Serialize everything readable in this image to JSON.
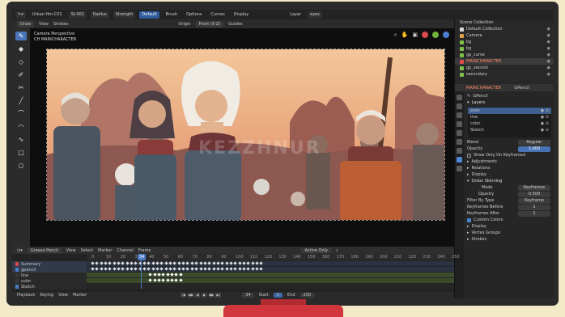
{
  "topbar": {
    "scene_menu": "Draw",
    "file_name": "Urban Hm-C01",
    "frame_label": "St.001",
    "mode_a": "Radius",
    "mode_b": "Strength",
    "active_object": "Default",
    "menus": [
      "Brush",
      "Options",
      "Curves",
      "Display"
    ],
    "layer_label": "Layer",
    "layer_value": "eyes"
  },
  "toolheader": {
    "mode": "Draw",
    "view": "View",
    "strokes": "Strokes",
    "origin_label": "Origin",
    "origin_value": "Front (X-Z)",
    "guides": "Guides"
  },
  "viewport": {
    "camera_label": "Camera Perspective",
    "object_label": "CH MAINCHARACTER",
    "watermark": "KEZZHNUR"
  },
  "tools": [
    "draw",
    "fill",
    "erase",
    "tint",
    "cutter",
    "line",
    "polyline",
    "arc",
    "curve",
    "box",
    "circle"
  ],
  "outliner": {
    "title": "Scene Collection",
    "items": [
      {
        "label": "Default Collection",
        "color": "#d8d8d8"
      },
      {
        "label": "Camera",
        "color": "#e2a24b"
      },
      {
        "label": "bg",
        "color": "#7fc14a"
      },
      {
        "label": "bg",
        "color": "#7fc14a"
      },
      {
        "label": "gp_curve",
        "color": "#7fc14a"
      },
      {
        "label": "MAINCHARACTER",
        "color": "#e04a4a"
      },
      {
        "label": "gp_second",
        "color": "#7fc14a"
      },
      {
        "label": "secondary",
        "color": "#7fc14a"
      }
    ]
  },
  "properties": {
    "header_obj": "MAINCHARACTER",
    "header_data": "GPencil",
    "datablock": "GPencil",
    "layers_title": "Layers",
    "layers": [
      "eyes",
      "line",
      "color",
      "Sketch"
    ],
    "blend_label": "Blend",
    "blend_value": "Regular",
    "opacity_label": "Opacity",
    "opacity_value": "1.000",
    "show_only_keyframed": "Show Only On Keyframed",
    "adjustments": "Adjustments",
    "relations": "Relations",
    "display": "Display",
    "onion_title": "Onion Skinning",
    "mode_label": "Mode",
    "mode_value": "Keyframes",
    "onion_opacity_label": "Opacity",
    "onion_opacity_value": "0.500",
    "filter_label": "Filter By Type",
    "filter_value": "Keyframe",
    "kf_before_label": "Keyframes Before",
    "kf_before_value": "1",
    "kf_after_label": "Keyframes After",
    "kf_after_value": "1",
    "custom_colors": "Custom Colors",
    "display2": "Display",
    "vertex_groups": "Vertex Groups",
    "strokes": "Strokes"
  },
  "timeline": {
    "mode": "Grease Pencil",
    "menus": [
      "View",
      "Select",
      "Marker",
      "Channel",
      "Frame"
    ],
    "filter": "Active Only",
    "current_frame": "34",
    "ruler": [
      "0",
      "10",
      "20",
      "30",
      "40",
      "50",
      "60",
      "70",
      "80",
      "90",
      "100",
      "110",
      "120",
      "130",
      "140",
      "150",
      "160",
      "170",
      "180",
      "190",
      "200",
      "210",
      "220",
      "230",
      "240",
      "250"
    ],
    "channels": [
      {
        "label": "Summary",
        "color": "#d04a4a"
      },
      {
        "label": "gpencil",
        "color": "#4a7ec8"
      },
      {
        "label": "line",
        "color": "#3a3a3a"
      },
      {
        "label": "color",
        "color": "#3a3a3a"
      },
      {
        "label": "Sketch",
        "color": "#4a7ec8"
      }
    ],
    "transport": {
      "playback": "Playback",
      "keying": "Keying",
      "view": "View",
      "marker": "Marker",
      "frame": "34",
      "start_label": "Start",
      "start_value": "1",
      "end_label": "End",
      "end_value": "250"
    }
  },
  "colors": {
    "accent": "#4a74b8",
    "monitor": "#2a2a2a",
    "stand": "#d2363d",
    "background": "#f1e9c7"
  }
}
